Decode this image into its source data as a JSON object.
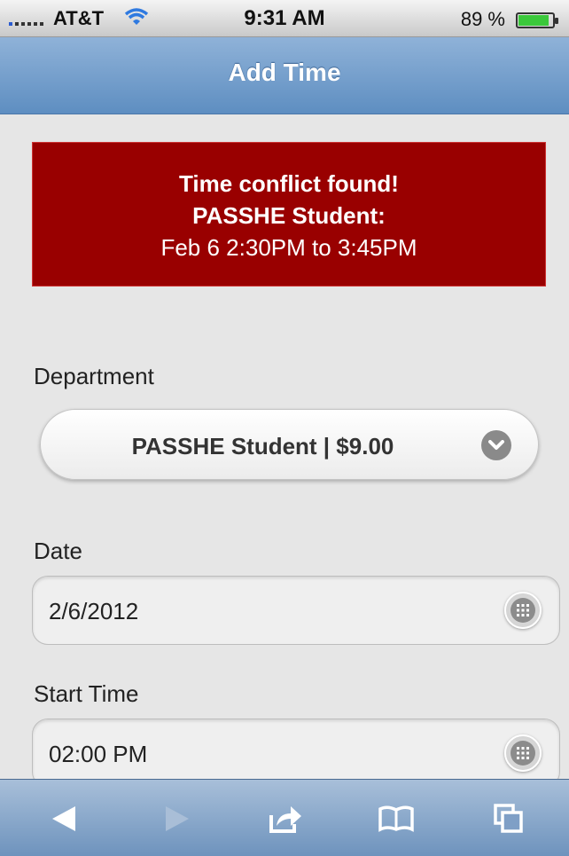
{
  "status_bar": {
    "carrier": "AT&T",
    "time": "9:31 AM",
    "battery_percent": "89 %",
    "battery_level": 0.89
  },
  "header": {
    "title": "Add Time"
  },
  "alert": {
    "line1": "Time conflict found!",
    "line2": "PASSHE Student:",
    "line3": "Feb 6 2:30PM to 3:45PM",
    "background_color": "#990000"
  },
  "form": {
    "department": {
      "label": "Department",
      "value": "PASSHE Student | $9.00",
      "icon": "chevron-down-icon"
    },
    "date": {
      "label": "Date",
      "value": "2/6/2012",
      "icon": "keypad-icon"
    },
    "start_time": {
      "label": "Start Time",
      "value": "02:00 PM",
      "icon": "keypad-icon"
    }
  },
  "toolbar": {
    "items": [
      "back-icon",
      "forward-icon",
      "share-icon",
      "bookmarks-icon",
      "tabs-icon"
    ]
  },
  "colors": {
    "header": "#6f9acb",
    "toolbar": "#7f9fc6",
    "background": "#e6e6e6"
  }
}
